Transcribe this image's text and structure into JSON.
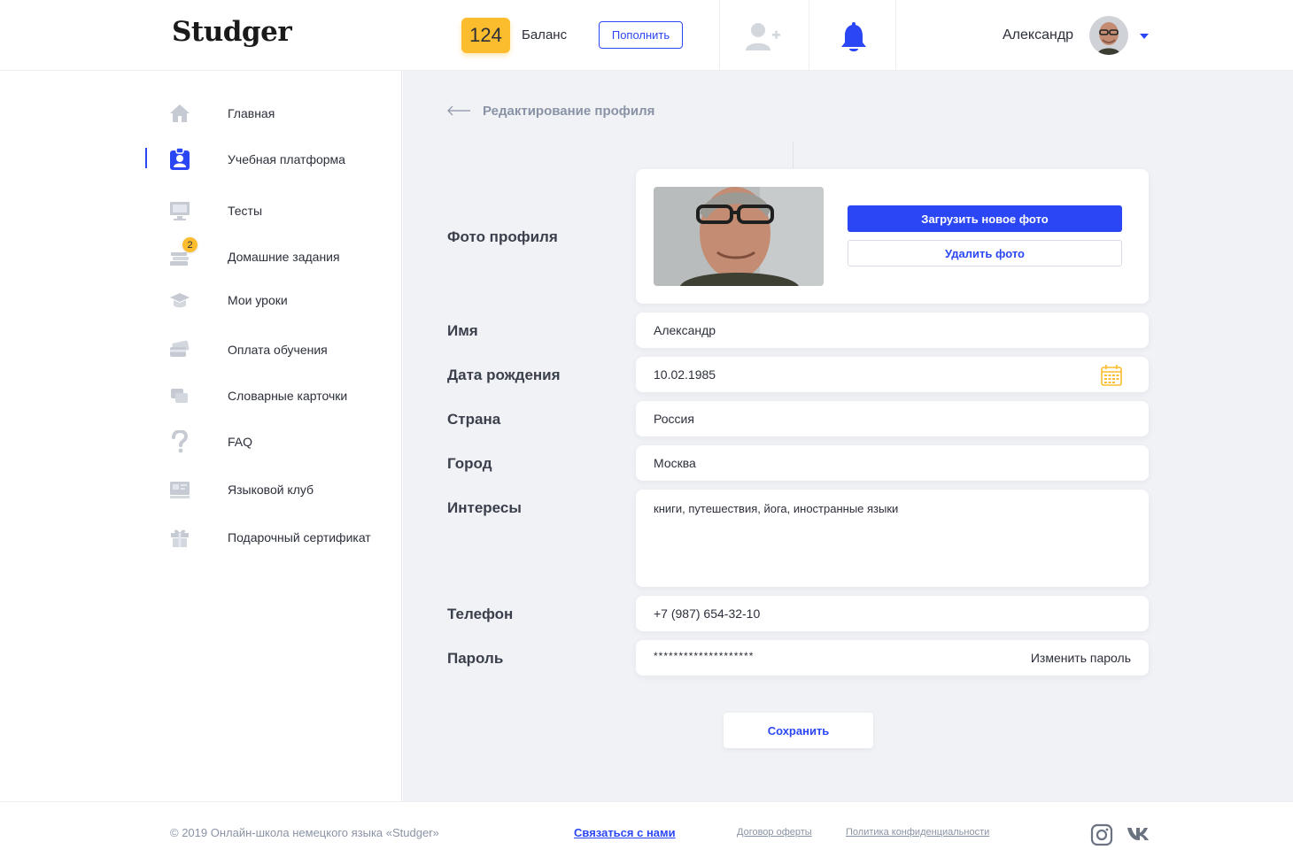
{
  "header": {
    "logo": "Studger",
    "balance_value": "124",
    "balance_label": "Баланс",
    "topup_label": "Пополнить",
    "user_name": "Александр"
  },
  "sidebar": {
    "items": [
      {
        "label": "Главная",
        "icon": "home-icon"
      },
      {
        "label": "Учебная платформа",
        "icon": "id-badge-icon",
        "active": true
      },
      {
        "label": "Тесты",
        "icon": "monitor-icon"
      },
      {
        "label": "Домашние задания",
        "icon": "books-icon",
        "badge": "2"
      },
      {
        "label": "Мои уроки",
        "icon": "graduation-cap-icon"
      },
      {
        "label": "Оплата обучения",
        "icon": "credit-card-icon"
      },
      {
        "label": "Словарные карточки",
        "icon": "cards-icon"
      },
      {
        "label": "FAQ",
        "icon": "question-icon"
      },
      {
        "label": "Языковой клуб",
        "icon": "club-icon"
      },
      {
        "label": "Подарочный сертификат",
        "icon": "gift-icon"
      }
    ]
  },
  "page": {
    "title": "Редактирование профиля"
  },
  "form": {
    "photo_label": "Фото профиля",
    "upload_label": "Загрузить новое фото",
    "delete_label": "Удалить фото",
    "name_label": "Имя",
    "name_value": "Александр",
    "birth_label": "Дата рождения",
    "birth_value": "10.02.1985",
    "country_label": "Страна",
    "country_value": "Россия",
    "city_label": "Город",
    "city_value": "Москва",
    "interests_label": "Интересы",
    "interests_value": "книги, путешествия, йога, иностранные языки",
    "phone_label": "Телефон",
    "phone_value": "+7 (987) 654-32-10",
    "password_label": "Пароль",
    "password_value": "********************",
    "change_password_label": "Изменить пароль",
    "save_label": "Сохранить"
  },
  "footer": {
    "copyright": "© 2019 Онлайн-школа немецкого языка «Studger»",
    "contact": "Связаться с нами",
    "offer": "Договор оферты",
    "privacy": "Политика конфиденциальности"
  },
  "colors": {
    "accent": "#2b47f5",
    "badge": "#fbbd2d",
    "icon_gray": "#c5cad3",
    "bg": "#f0f2f6"
  }
}
